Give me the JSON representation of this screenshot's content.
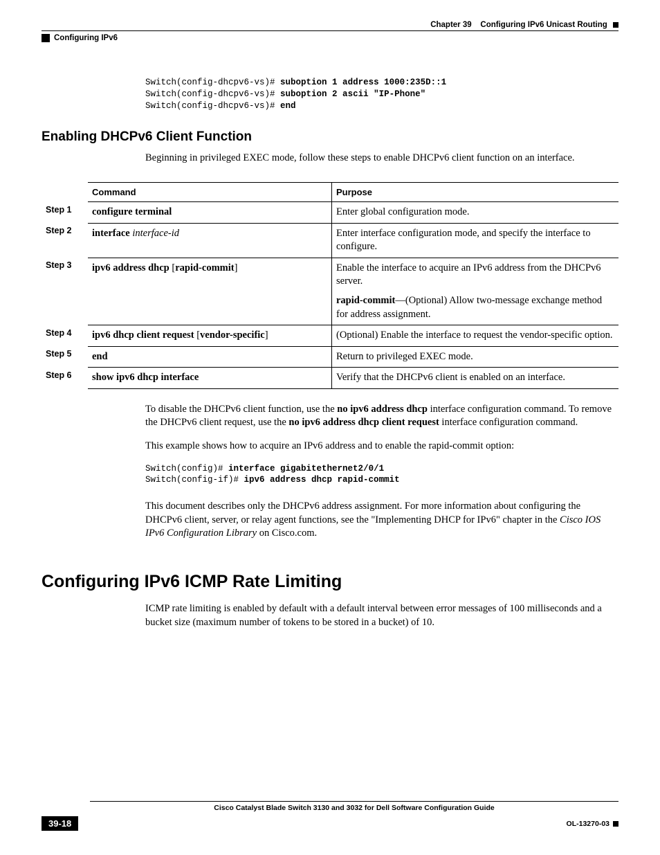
{
  "header": {
    "chapter": "Chapter 39",
    "title": "Configuring IPv6 Unicast Routing",
    "section": "Configuring IPv6"
  },
  "code1": {
    "l1p": "Switch(config-dhcpv6-vs)# ",
    "l1c": "suboption 1 address 1000:235D::1",
    "l2p": "Switch(config-dhcpv6-vs)# ",
    "l2c": "suboption 2 ascii \"IP-Phone\"",
    "l3p": "Switch(config-dhcpv6-vs)# ",
    "l3c": "end"
  },
  "s1": {
    "heading": "Enabling DHCPv6 Client Function",
    "intro": "Beginning in privileged EXEC mode, follow these steps to enable DHCPv6 client function on an interface."
  },
  "table": {
    "h_cmd": "Command",
    "h_purpose": "Purpose",
    "r1": {
      "step": "Step 1",
      "cmd_b": "configure terminal",
      "purpose": "Enter global configuration mode."
    },
    "r2": {
      "step": "Step 2",
      "cmd_b": "interface",
      "cmd_i": " interface-id",
      "purpose": "Enter interface configuration mode, and specify the interface to configure."
    },
    "r3": {
      "step": "Step 3",
      "cmd_b": "ipv6 address dhcp",
      "cmd_n1": " [",
      "cmd_b2": "rapid-commit",
      "cmd_n2": "]",
      "purpose1": "Enable the interface to acquire an IPv6 address from the DHCPv6 server.",
      "rc_b": "rapid-commit",
      "rc_rest": "—(Optional) Allow two-message exchange method for address assignment."
    },
    "r4": {
      "step": "Step 4",
      "cmd_b": "ipv6 dhcp client request",
      "cmd_n1": " [",
      "cmd_b2": "vendor-specific",
      "cmd_n2": "]",
      "purpose": "(Optional) Enable the interface to request the vendor-specific option."
    },
    "r5": {
      "step": "Step 5",
      "cmd_b": "end",
      "purpose": "Return to privileged EXEC mode."
    },
    "r6": {
      "step": "Step 6",
      "cmd_b": "show ipv6 dhcp interface",
      "purpose": "Verify that the DHCPv6 client is enabled on an interface."
    }
  },
  "post": {
    "p1a": "To disable the DHCPv6 client function, use the ",
    "p1b": "no ipv6 address dhcp",
    "p1c": " interface configuration command. To remove the DHCPv6 client request, use the ",
    "p1d": "no ipv6 address dhcp client request",
    "p1e": " interface configuration command.",
    "p2": "This example shows how to acquire an IPv6 address and to enable the rapid-commit option:"
  },
  "code2": {
    "l1p": "Switch(config)# ",
    "l1c": "interface gigabitethernet2/0/1",
    "l2p": "Switch(config-if)# ",
    "l2c": "ipv6 address dhcp rapid-commit"
  },
  "post2": {
    "a": "This document describes only the DHCPv6 address assignment. For more information about configuring the DHCPv6 client, server, or relay agent functions, see the \"Implementing DHCP for IPv6\" chapter in the ",
    "b": "Cisco IOS IPv6 Configuration Library",
    "c": " on Cisco.com."
  },
  "s2": {
    "heading": "Configuring IPv6 ICMP Rate Limiting",
    "intro": "ICMP rate limiting is enabled by default with a default interval between error messages of 100 milliseconds and a bucket size (maximum number of tokens to be stored in a bucket) of 10."
  },
  "footer": {
    "guide": "Cisco Catalyst Blade Switch 3130 and 3032 for Dell Software Configuration Guide",
    "page": "39-18",
    "docid": "OL-13270-03"
  }
}
